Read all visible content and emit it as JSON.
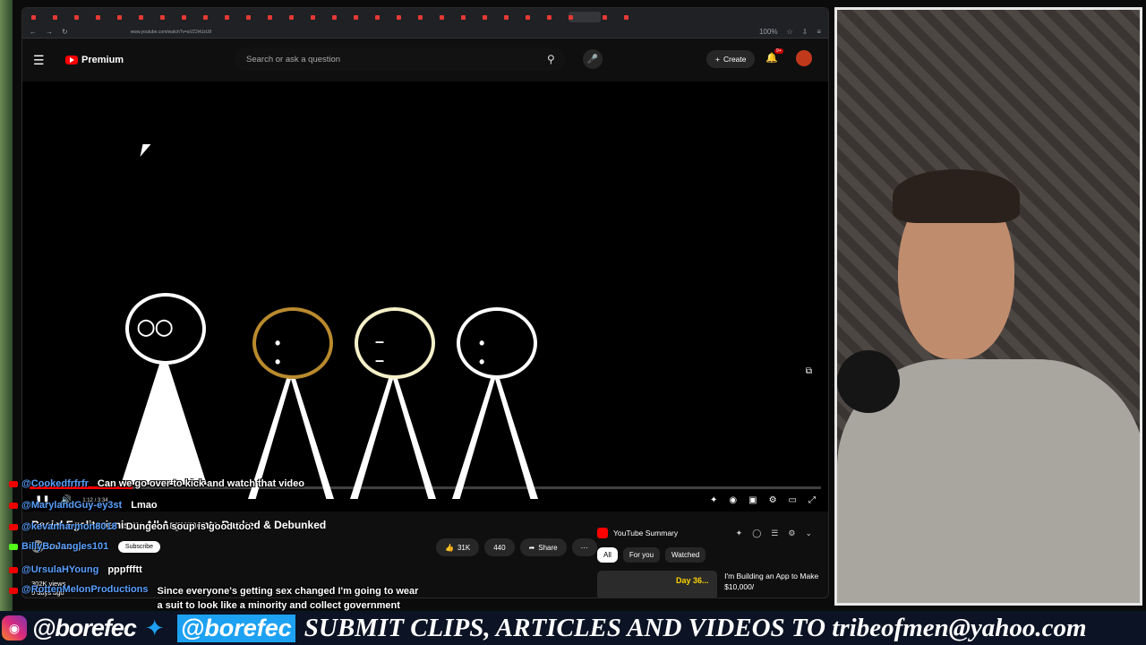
{
  "browser": {
    "url": "www.youtube.com/watch?v=aVZ2i4JzU8",
    "zoom": "100%",
    "tab_count": 30
  },
  "header": {
    "logo_text": "Premium",
    "search_placeholder": "Search or ask a question",
    "create_label": "Create",
    "notification_badge": "9+"
  },
  "video": {
    "time": "1:12 / 3:34",
    "progress_fraction": 0.13
  },
  "info": {
    "title": "Racial Egalitarianism: All Arguments Ranked & Debunked",
    "channel": "Basic Logic",
    "subscribe_label": "Subscribe",
    "likes": "31K",
    "dislikes": "440",
    "share_label": "Share",
    "views_line": "302K views",
    "age_line": "9 days ago"
  },
  "sidebar": {
    "summary_title": "YouTube Summary",
    "chips": [
      "All",
      "For you",
      "Watched"
    ],
    "rec_thumb_text": "Day 36...",
    "rec_title": "I'm Building an App to Make $10,000/"
  },
  "chat": [
    {
      "user": "@Cookedfrfrfr",
      "text": "Can we go over to kick and watch that video"
    },
    {
      "user": "@MarylandGuy-ey3st",
      "text": "Lmao"
    },
    {
      "user": "@kevanharmon8018",
      "text": "Dungeon soup is good too."
    },
    {
      "user": "BillyBoJangles101",
      "text": ""
    },
    {
      "user": "@UrsulaHYoung",
      "text": "pppffftt"
    },
    {
      "user": "@RottenMelonProductions",
      "text": "Since everyone's getting sex changed I'm going to wear a suit to look like a minority and collect government Bennie's"
    }
  ],
  "banner": {
    "instagram": "@borefec",
    "twitter": "@borefec",
    "message": "SUBMIT CLIPS, ARTICLES AND VIDEOS TO tribeofmen@yahoo.com"
  },
  "colors": {
    "brand_red": "#ff0000",
    "chat_user": "#5aa0ff",
    "banner_bg": "#0c1324"
  }
}
